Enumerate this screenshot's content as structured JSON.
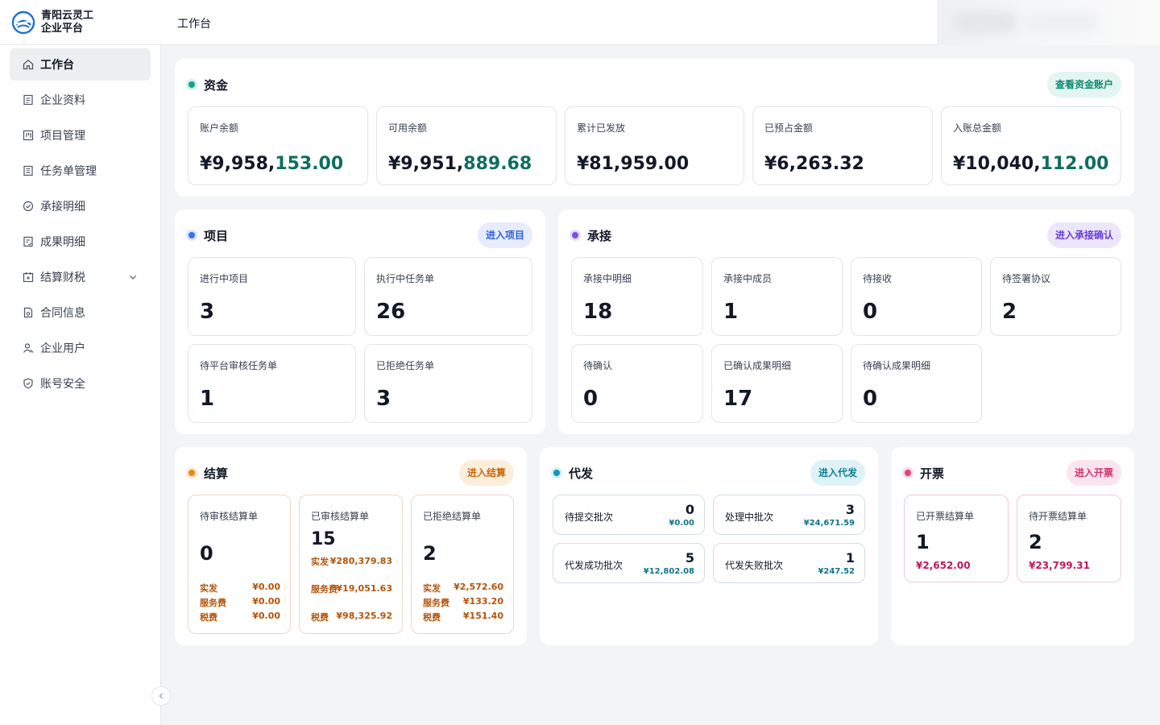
{
  "app": {
    "name_line1": "青阳云灵工",
    "name_line2": "企业平台",
    "page_title": "工作台"
  },
  "sidebar": {
    "items": [
      {
        "label": "工作台",
        "icon": "home-icon",
        "active": true
      },
      {
        "label": "企业资料",
        "icon": "document-icon"
      },
      {
        "label": "项目管理",
        "icon": "kanban-icon"
      },
      {
        "label": "任务单管理",
        "icon": "list-icon"
      },
      {
        "label": "承接明细",
        "icon": "check-circle-icon"
      },
      {
        "label": "成果明细",
        "icon": "result-icon"
      },
      {
        "label": "结算财税",
        "icon": "calendar-icon",
        "expandable": true
      },
      {
        "label": "合同信息",
        "icon": "contract-icon"
      },
      {
        "label": "企业用户",
        "icon": "users-icon"
      },
      {
        "label": "账号安全",
        "icon": "shield-icon"
      }
    ]
  },
  "fund": {
    "title": "资金",
    "action": "查看资金账户",
    "color": "#14a38b",
    "cards": [
      {
        "label": "账户余额",
        "head": "¥9,958,",
        "tail": "153.00"
      },
      {
        "label": "可用余额",
        "head": "¥9,951,",
        "tail": "889.68"
      },
      {
        "label": "累计已发放",
        "head": "¥81,959.00",
        "tail": ""
      },
      {
        "label": "已预占金额",
        "head": "¥6,263.32",
        "tail": ""
      },
      {
        "label": "入账总金额",
        "head": "¥10,040,",
        "tail": "112.00"
      }
    ]
  },
  "project": {
    "title": "项目",
    "action": "进入项目",
    "color": "#3b6ef5",
    "cards": [
      {
        "label": "进行中项目",
        "value": "3"
      },
      {
        "label": "执行中任务单",
        "value": "26"
      },
      {
        "label": "待平台审核任务单",
        "value": "1"
      },
      {
        "label": "已拒绝任务单",
        "value": "3"
      }
    ]
  },
  "accept": {
    "title": "承接",
    "action": "进入承接确认",
    "color": "#7c4dea",
    "cards": [
      {
        "label": "承接中明细",
        "value": "18"
      },
      {
        "label": "承接中成员",
        "value": "1"
      },
      {
        "label": "待接收",
        "value": "0"
      },
      {
        "label": "待签署协议",
        "value": "2"
      },
      {
        "label": "待确认",
        "value": "0"
      },
      {
        "label": "已确认成果明细",
        "value": "17"
      },
      {
        "label": "待确认成果明细",
        "value": "0"
      }
    ]
  },
  "settle": {
    "title": "结算",
    "action": "进入结算",
    "color": "#e58a12",
    "cards": [
      {
        "label": "待审核结算单",
        "value": "0",
        "rows": [
          {
            "k": "实发",
            "v": "¥0.00"
          },
          {
            "k": "服务费",
            "v": "¥0.00"
          },
          {
            "k": "税费",
            "v": "¥0.00"
          }
        ]
      },
      {
        "label": "已审核结算单",
        "value": "15",
        "rows": [
          {
            "k": "实发",
            "v": "¥280,379.83"
          },
          {
            "k": "服务费",
            "v": "¥19,051.63"
          },
          {
            "k": "税费",
            "v": "¥98,325.92"
          }
        ]
      },
      {
        "label": "已拒绝结算单",
        "value": "2",
        "rows": [
          {
            "k": "实发",
            "v": "¥2,572.60"
          },
          {
            "k": "服务费",
            "v": "¥133.20"
          },
          {
            "k": "税费",
            "v": "¥151.40"
          }
        ]
      }
    ]
  },
  "payout": {
    "title": "代发",
    "action": "进入代发",
    "color": "#1597b3",
    "cards": [
      {
        "label": "待提交批次",
        "count": "0",
        "amount": "¥0.00"
      },
      {
        "label": "处理中批次",
        "count": "3",
        "amount": "¥24,671.59"
      },
      {
        "label": "代发成功批次",
        "count": "5",
        "amount": "¥12,802.08"
      },
      {
        "label": "代发失败批次",
        "count": "1",
        "amount": "¥247.52"
      }
    ]
  },
  "invoice": {
    "title": "开票",
    "action": "进入开票",
    "color": "#e0407a",
    "cards": [
      {
        "label": "已开票结算单",
        "value": "1",
        "amount": "¥2,652.00"
      },
      {
        "label": "待开票结算单",
        "value": "2",
        "amount": "¥23,799.31"
      }
    ]
  }
}
